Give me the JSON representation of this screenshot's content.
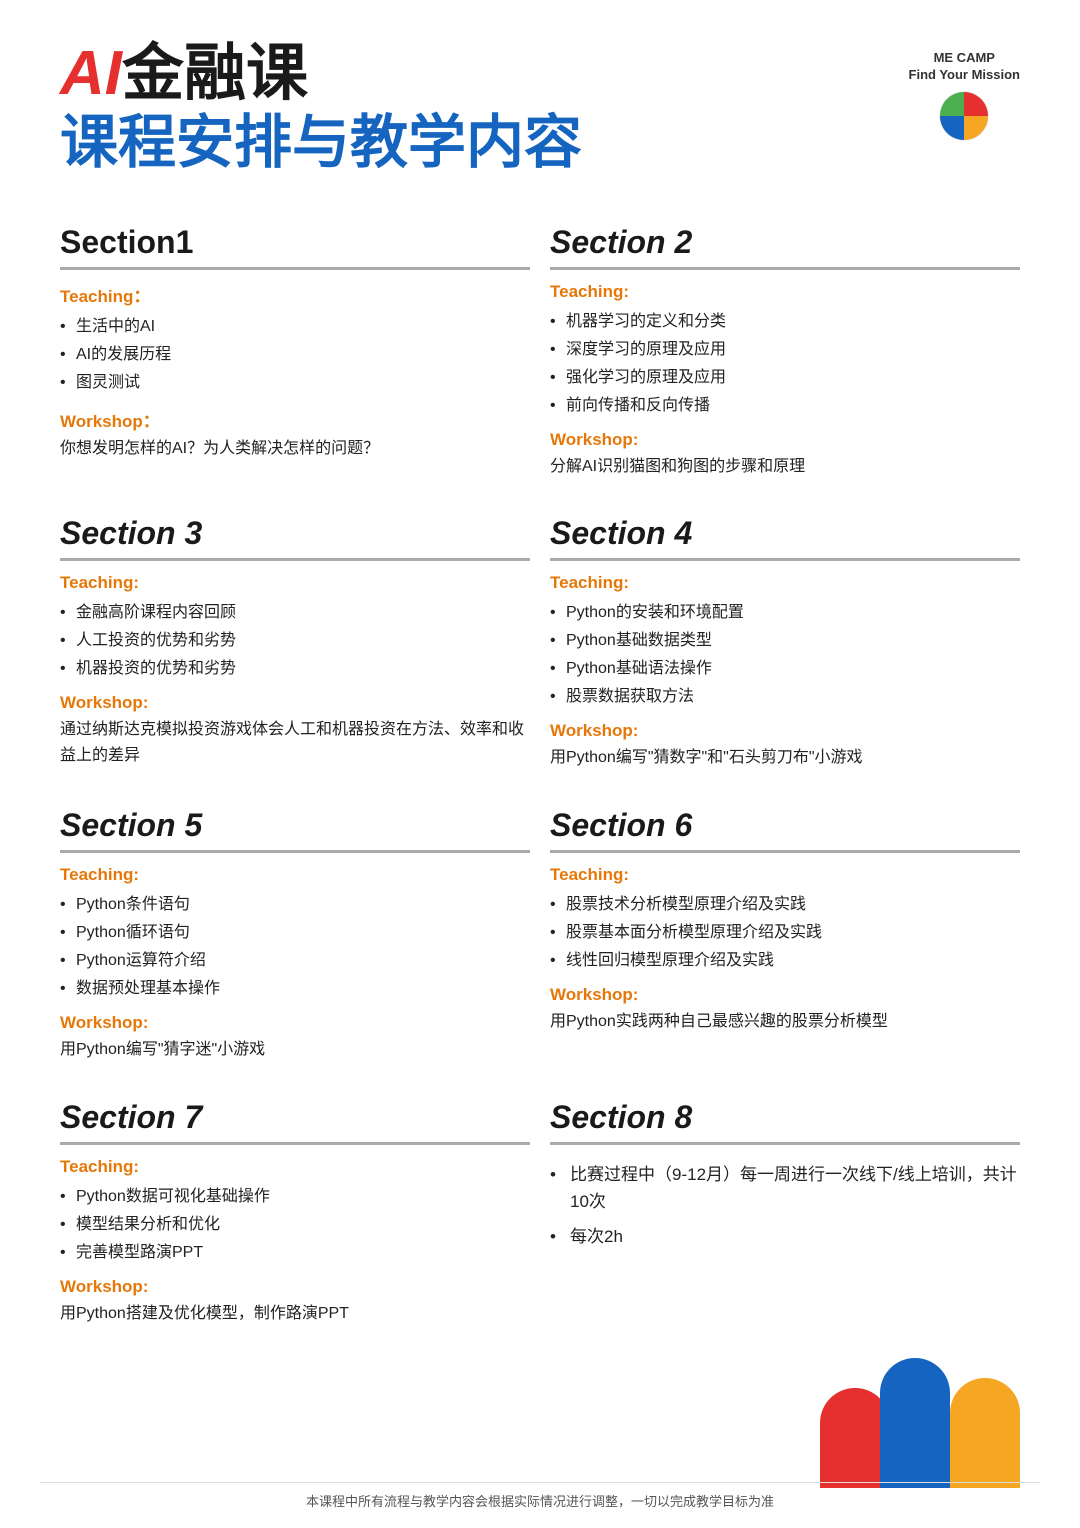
{
  "header": {
    "title_ai": "AI",
    "title_line1_rest": "金融课",
    "title_line2": "课程安排与教学内容",
    "logo_line1": "ME CAMP",
    "logo_line2": "Find Your Mission"
  },
  "sections": [
    {
      "id": "s1",
      "title": "Section1",
      "italic": false,
      "teaching_label": "Teaching：",
      "teaching_items": [
        "生活中的AI",
        "AI的发展历程",
        "图灵测试"
      ],
      "workshop_label": "Workshop：",
      "workshop_text": "你想发明怎样的AI？为人类解决怎样的问题？"
    },
    {
      "id": "s2",
      "title": "Section 2",
      "italic": true,
      "teaching_label": "Teaching:",
      "teaching_items": [
        "机器学习的定义和分类",
        "深度学习的原理及应用",
        "强化学习的原理及应用",
        "前向传播和反向传播"
      ],
      "workshop_label": "Workshop:",
      "workshop_text": "分解AI识别猫图和狗图的步骤和原理"
    },
    {
      "id": "s3",
      "title": "Section 3",
      "italic": true,
      "teaching_label": "Teaching:",
      "teaching_items": [
        "金融高阶课程内容回顾",
        "人工投资的优势和劣势",
        "机器投资的优势和劣势"
      ],
      "workshop_label": "Workshop:",
      "workshop_text": "通过纳斯达克模拟投资游戏体会人工和机器投资在方法、效率和收益上的差异"
    },
    {
      "id": "s4",
      "title": "Section 4",
      "italic": true,
      "teaching_label": "Teaching:",
      "teaching_items": [
        "Python的安装和环境配置",
        "Python基础数据类型",
        "Python基础语法操作",
        "股票数据获取方法"
      ],
      "workshop_label": "Workshop:",
      "workshop_text": "用Python编写\"猜数字\"和\"石头剪刀布\"小游戏"
    },
    {
      "id": "s5",
      "title": "Section 5",
      "italic": true,
      "teaching_label": "Teaching:",
      "teaching_items": [
        "Python条件语句",
        "Python循环语句",
        "Python运算符介绍",
        "数据预处理基本操作"
      ],
      "workshop_label": "Workshop:",
      "workshop_text": "用Python编写\"猜字迷\"小游戏"
    },
    {
      "id": "s6",
      "title": "Section 6",
      "italic": true,
      "teaching_label": "Teaching:",
      "teaching_items": [
        "股票技术分析模型原理介绍及实践",
        "股票基本面分析模型原理介绍及实践",
        "线性回归模型原理介绍及实践"
      ],
      "workshop_label": "Workshop:",
      "workshop_text": "用Python实践两种自己最感兴趣的股票分析模型"
    },
    {
      "id": "s7",
      "title": "Section 7",
      "italic": true,
      "teaching_label": "Teaching:",
      "teaching_items": [
        "Python数据可视化基础操作",
        "模型结果分析和优化",
        "完善模型路演PPT"
      ],
      "workshop_label": "Workshop:",
      "workshop_text": "用Python搭建及优化模型，制作路演PPT"
    },
    {
      "id": "s8",
      "title": "Section 8",
      "italic": true,
      "is_special": true,
      "items": [
        "比赛过程中（9-12月）每一周进行一次线下/线上培训，共计10次",
        "每次2h"
      ]
    }
  ],
  "footer": {
    "note": "本课程中所有流程与教学内容会根据实际情况进行调整，一切以完成教学目标为准"
  }
}
